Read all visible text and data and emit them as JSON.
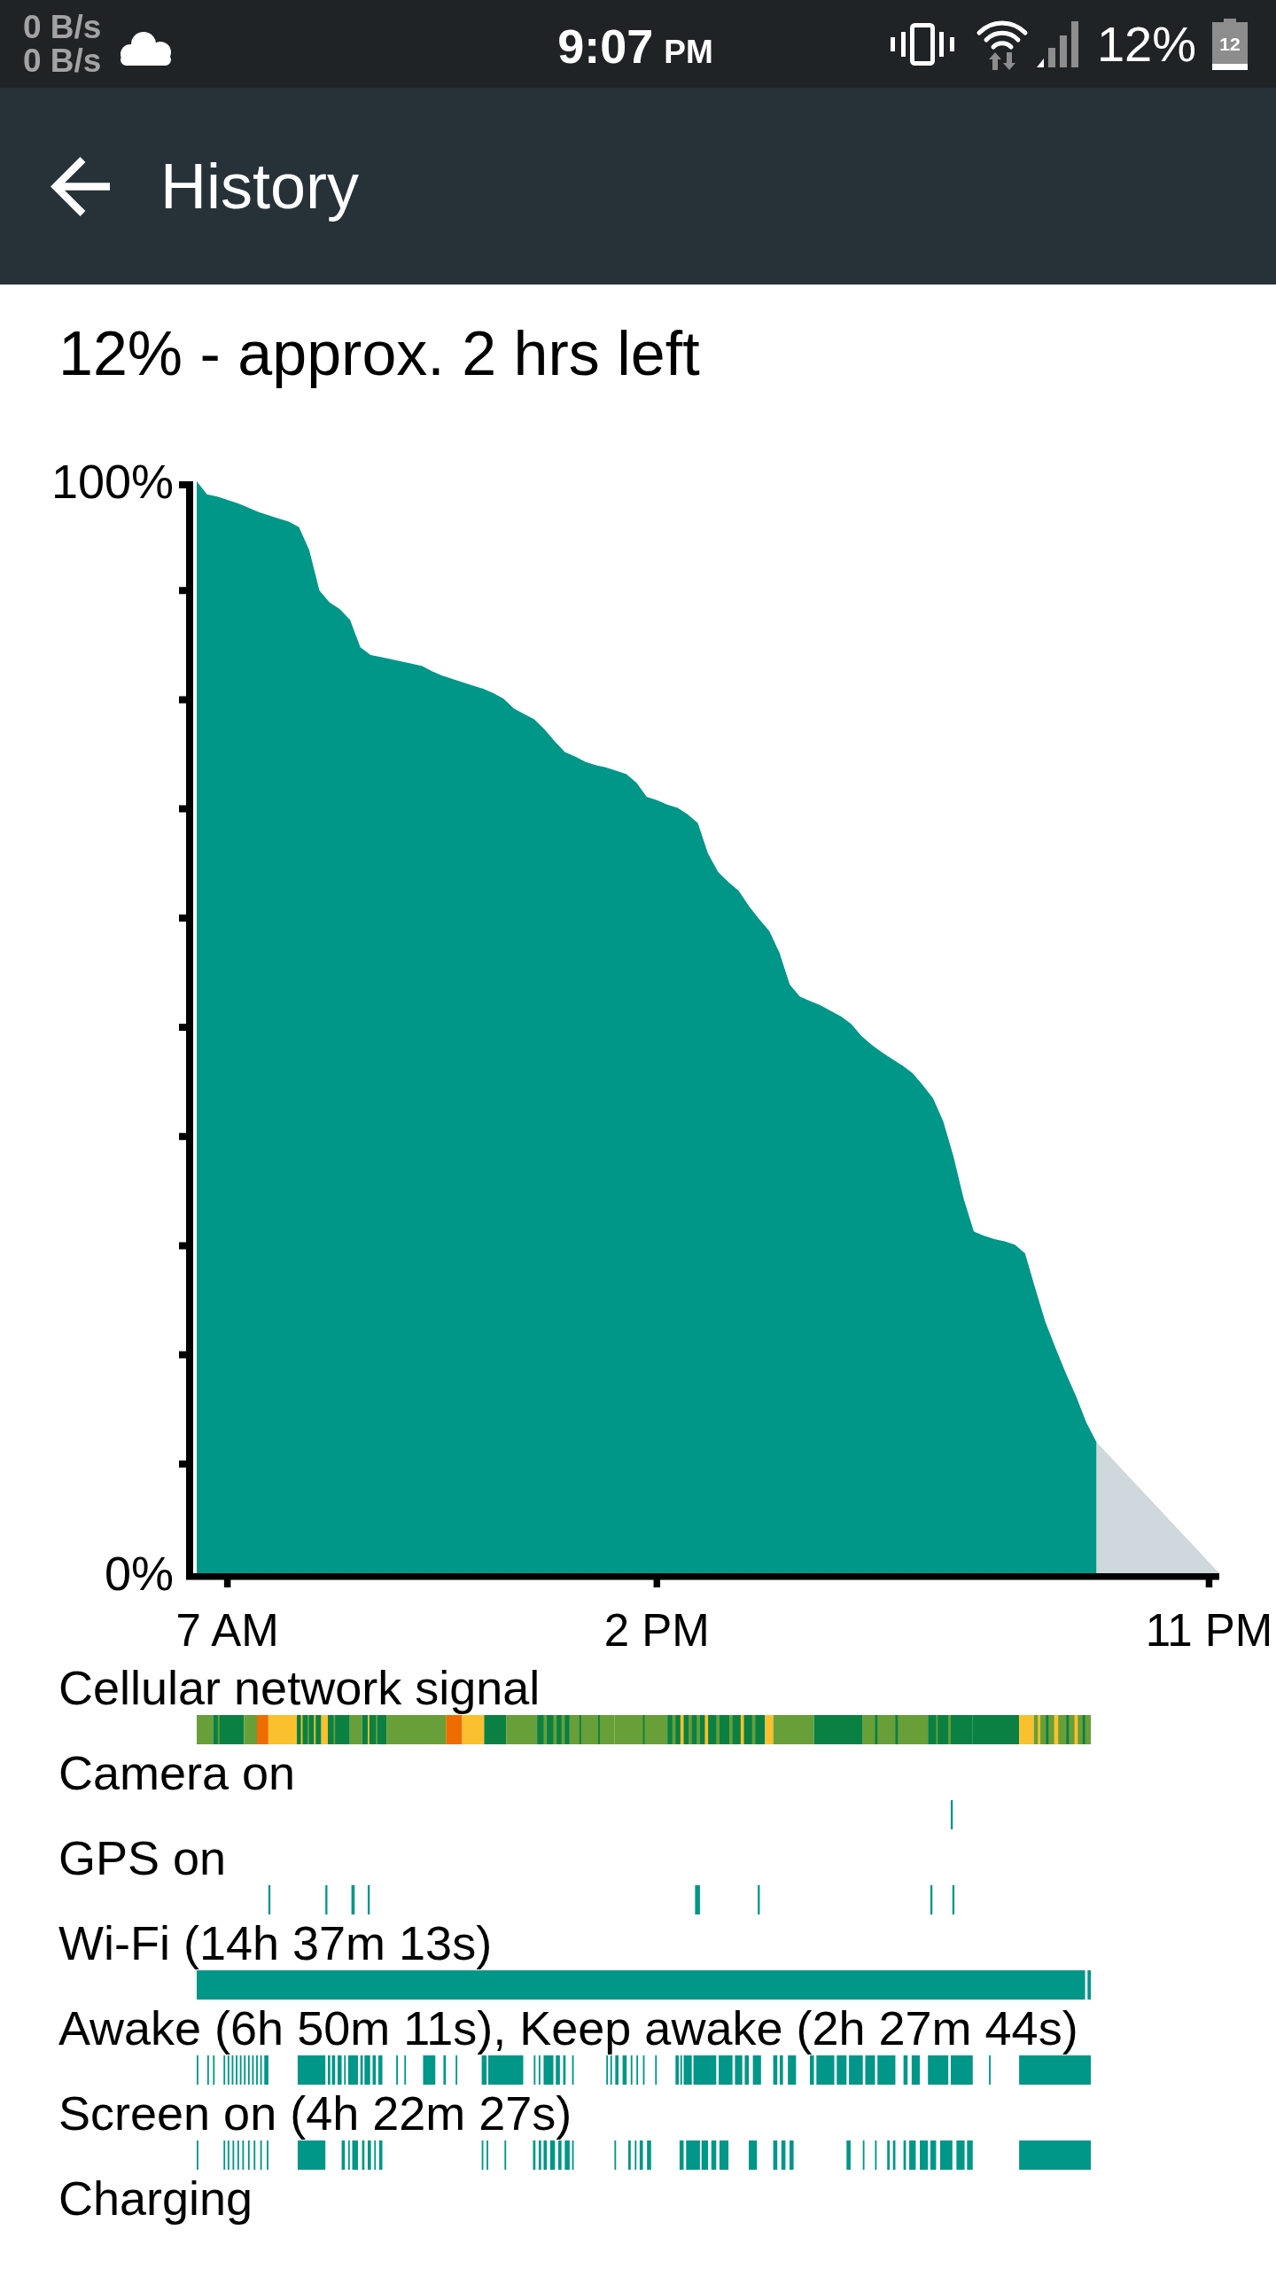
{
  "status_bar": {
    "data_rates": [
      "0 B/s",
      "0 B/s"
    ],
    "time": "9:07",
    "meridiem": "PM",
    "battery_percent": "12%",
    "battery_icon_label": "12"
  },
  "app_bar": {
    "title": "History"
  },
  "history": {
    "summary": "12% - approx. 2 hrs left",
    "chart_data": {
      "type": "area",
      "categories": [
        null,
        null,
        null,
        "7 AM",
        null,
        null,
        null,
        null,
        null,
        null,
        null,
        null,
        null,
        null,
        null,
        null,
        null,
        null,
        null,
        null,
        null,
        null,
        null,
        null,
        null,
        null,
        null,
        null,
        null,
        null,
        null,
        null,
        null,
        null,
        null,
        null,
        null,
        null,
        null,
        null,
        null,
        null,
        null,
        null,
        null,
        "2 PM",
        null,
        null,
        null,
        null,
        null,
        null,
        null,
        null,
        null,
        null,
        null,
        null,
        null,
        null,
        null,
        null,
        null,
        null,
        null,
        null,
        null,
        null,
        null,
        null,
        null,
        null,
        null,
        null,
        null,
        null,
        null,
        null,
        null,
        null,
        null,
        null,
        null,
        null,
        null,
        null,
        null,
        null,
        null,
        null,
        null,
        null,
        null,
        null,
        null,
        null,
        null,
        null,
        null,
        "11 PM",
        null
      ],
      "series": [
        {
          "color": "#009688",
          "values": [
            100,
            98.8,
            98.6,
            98.3,
            98,
            97.6,
            97.2,
            96.9,
            96.6,
            96.3,
            95.8,
            93.7,
            90,
            88.9,
            88.3,
            87.3,
            84.8,
            84.1,
            83.9,
            83.7,
            83.5,
            83.3,
            83.1,
            82.6,
            82.2,
            81.9,
            81.6,
            81.3,
            81,
            80.6,
            80.1,
            79.2,
            78.7,
            78.2,
            77.3,
            76.2,
            75.2,
            74.8,
            74.3,
            74,
            73.8,
            73.5,
            73.2,
            72.4,
            71.1,
            70.8,
            70.4,
            70.1,
            69.5,
            68.7,
            65.9,
            64.2,
            63.3,
            62.5,
            61.1,
            59.9,
            58.8,
            56.8,
            53.9,
            52.8,
            52.4,
            52,
            51.5,
            51,
            50.3,
            49.2,
            48.4,
            47.7,
            47.1,
            46.5,
            45.8,
            44.7,
            43.5,
            41.4,
            38.2,
            34.3,
            31.3,
            30.9,
            30.6,
            30.4,
            30.1,
            29.3,
            26.1,
            23,
            20.6,
            18.3,
            16.2,
            13.8,
            12,
            null,
            null,
            null,
            null,
            null,
            null,
            null,
            null,
            null,
            null,
            null,
            null
          ]
        },
        {
          "color": "#cfd8dc",
          "values": [
            null,
            null,
            null,
            null,
            null,
            null,
            null,
            null,
            null,
            null,
            null,
            null,
            null,
            null,
            null,
            null,
            null,
            null,
            null,
            null,
            null,
            null,
            null,
            null,
            null,
            null,
            null,
            null,
            null,
            null,
            null,
            null,
            null,
            null,
            null,
            null,
            null,
            null,
            null,
            null,
            null,
            null,
            null,
            null,
            null,
            null,
            null,
            null,
            null,
            null,
            null,
            null,
            null,
            null,
            null,
            null,
            null,
            null,
            null,
            null,
            null,
            null,
            null,
            null,
            null,
            null,
            null,
            null,
            null,
            null,
            null,
            null,
            null,
            null,
            null,
            null,
            null,
            null,
            null,
            null,
            null,
            null,
            null,
            null,
            null,
            null,
            null,
            null,
            12,
            11,
            10,
            9,
            8,
            7,
            6,
            5,
            4,
            3,
            2,
            1,
            0
          ]
        }
      ],
      "ylim": [
        0,
        100
      ],
      "yticks": [
        {
          "value": 0,
          "label": "0%"
        },
        {
          "value": 100,
          "label": "100%"
        }
      ]
    },
    "timelines": [
      {
        "kind": "signal",
        "label": "Cellular network signal"
      },
      {
        "kind": "camera",
        "label": "Camera on"
      },
      {
        "kind": "gps",
        "label": "GPS on"
      },
      {
        "kind": "wifi",
        "label": "Wi-Fi (14h 37m 13s)"
      },
      {
        "kind": "awake",
        "label": "Awake (6h 50m 11s), Keep awake (2h 27m 44s)"
      },
      {
        "kind": "screen",
        "label": "Screen on (4h 22m 27s)"
      },
      {
        "kind": "charging",
        "label": "Charging"
      }
    ]
  }
}
